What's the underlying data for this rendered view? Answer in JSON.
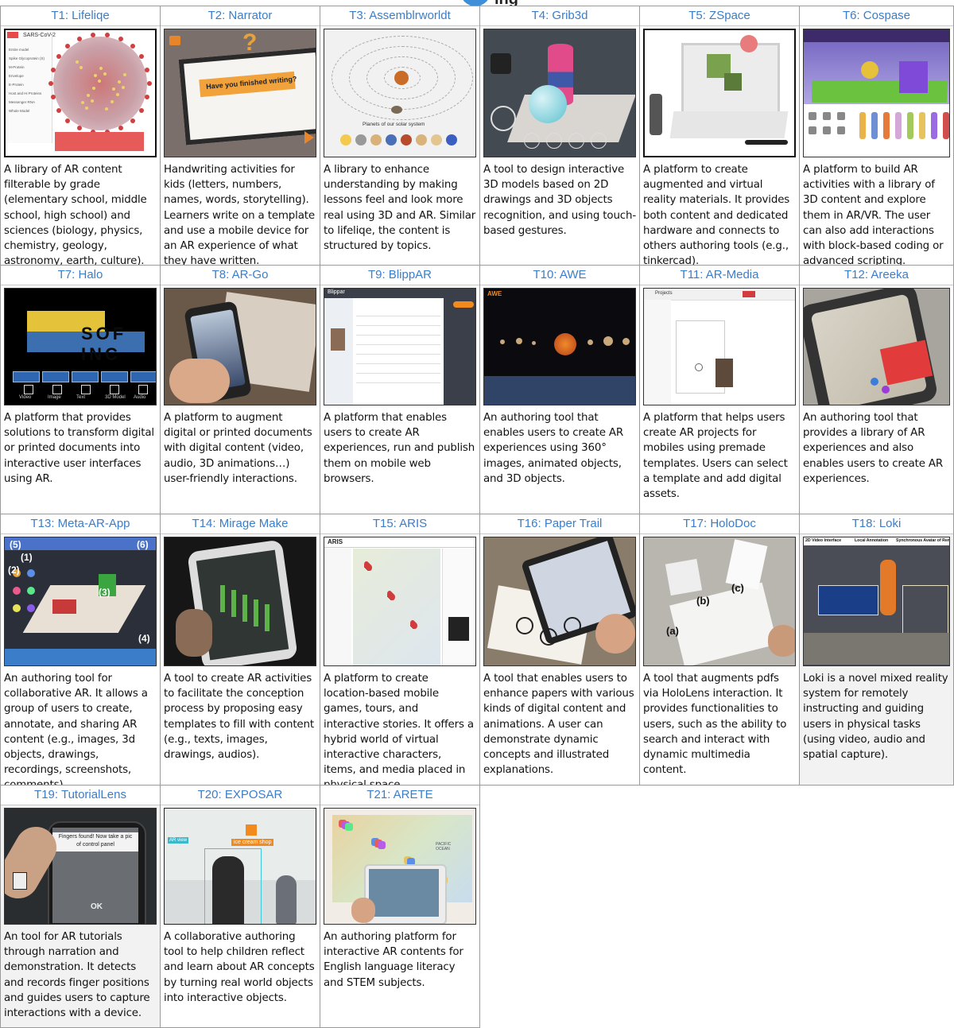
{
  "banner": {
    "text": "ing"
  },
  "tools": [
    {
      "id": "T1",
      "title": "T1: Lifeliqe",
      "image": "virus-model-icon",
      "description": "A library of AR content filterable by grade (elementary school, middle school, high school) and sciences (biology, physics, chemistry, geology, astronomy, earth, culture)."
    },
    {
      "id": "T2",
      "title": "T2: Narrator",
      "image": "handwriting-sheet-icon",
      "description": "Handwriting activities for kids (letters, numbers, names, words, storytelling). Learners write on a template and use a mobile device for an AR experience of what they have written."
    },
    {
      "id": "T3",
      "title": "T3: Assemblrworldt",
      "image": "solar-system-icon",
      "description": "A library to enhance understanding by making lessons feel and look more real using 3D and AR. Similar to lifeliqe, the content is structured by topics."
    },
    {
      "id": "T4",
      "title": "T4: Grib3d",
      "image": "3d-objects-icon",
      "description": "A tool to design interactive 3D models based on 2D drawings and 3D objects recognition, and using touch-based gestures."
    },
    {
      "id": "T5",
      "title": "T5: ZSpace",
      "image": "laptop-hardware-icon",
      "description": "A platform to create augmented and virtual reality materials. It provides both content and dedicated hardware and connects to others authoring tools (e.g., tinkercad)."
    },
    {
      "id": "T6",
      "title": "T6: Cospase",
      "image": "3d-scene-editor-icon",
      "description": "A platform to build AR activities with a library of 3D content and explore them in AR/VR. The user can also add interactions with block-based coding or advanced scripting."
    },
    {
      "id": "T7",
      "title": "T7: Halo",
      "image": "media-toolbar-icon",
      "description": "A platform that provides solutions to transform digital or printed documents into interactive user interfaces using AR."
    },
    {
      "id": "T8",
      "title": "T8: AR-Go",
      "image": "phone-over-book-icon",
      "description": "A platform to augment digital or printed documents with digital content (video, audio, 3D animations…) user-friendly interactions."
    },
    {
      "id": "T9",
      "title": "T9: BlippAR",
      "image": "web-editor-icon",
      "description": "A platform that enables users to create AR experiences, run and publish them on mobile web browsers."
    },
    {
      "id": "T10",
      "title": "T10: AWE",
      "image": "planets-icon",
      "description": "An authoring tool that enables users to create AR experiences using 360° images, animated objects, and 3D objects."
    },
    {
      "id": "T11",
      "title": "T11: AR-Media",
      "image": "project-template-icon",
      "description": "A platform that helps users create AR projects for mobiles using premade templates. Users can select a template and add digital assets."
    },
    {
      "id": "T12",
      "title": "T12: Areeka",
      "image": "phone-ar-cards-icon",
      "description": "An authoring tool that provides a library of AR experiences and also enables users to create AR experiences."
    },
    {
      "id": "T13",
      "title": "T13: Meta-AR-App",
      "image": "collab-workspace-icon",
      "description": "An authoring tool for collaborative AR. It allows a group of users to create, annotate, and sharing AR content (e.g., images, 3d objects, drawings, recordings, screenshots, comments)."
    },
    {
      "id": "T14",
      "title": "T14: Mirage Make",
      "image": "phone-3d-model-icon",
      "description": "A tool to create AR activities to facilitate the conception process by proposing easy templates to fill with content (e.g., texts, images, drawings, audios)."
    },
    {
      "id": "T15",
      "title": "T15: ARIS",
      "image": "location-map-icon",
      "description": "A platform to create location-based mobile games, tours, and interactive stories. It offers a hybrid world of virtual interactive characters, items, and media placed in physical space."
    },
    {
      "id": "T16",
      "title": "T16: Paper Trail",
      "image": "tablet-paper-icon",
      "description": "A tool that enables users to enhance papers with various kinds of digital content and animations. A user can demonstrate dynamic concepts and illustrated explanations."
    },
    {
      "id": "T17",
      "title": "T17: HoloDoc",
      "image": "documents-desk-icon",
      "description": "A tool that augments pdfs via HoloLens interaction. It provides functionalities to users, such as the ability to search and interact with dynamic multimedia content."
    },
    {
      "id": "T18",
      "title": "T18: Loki",
      "image": "mixed-reality-room-icon",
      "description": "Loki is a novel mixed reality system for remotely instructing and guiding users in physical tasks (using video, audio and spatial capture)."
    },
    {
      "id": "T19",
      "title": "T19: TutorialLens",
      "image": "phone-finger-icon",
      "description": "An tool for AR tutorials through narration and demonstration. It detects and records finger positions and guides users to capture interactions with a device."
    },
    {
      "id": "T20",
      "title": "T20: EXPOSAR",
      "image": "children-ar-room-icon",
      "description": "A collaborative authoring tool to help children reflect and learn about AR concepts by turning real world objects into interactive objects."
    },
    {
      "id": "T21",
      "title": "T21: ARETE",
      "image": "tablet-world-map-icon",
      "description": "An authoring platform for interactive AR contents for English language literacy and STEM subjects."
    }
  ],
  "image_text": {
    "t1_label": "SARS-CoV-2",
    "t1_menu": [
      "Entire model",
      "Spike Glycoprotein (S)",
      "M-Protein",
      "Envelope",
      "E-Protein",
      "Host and Hi Proteins",
      "Messenger RNA",
      "Whole Model"
    ],
    "t2_banner": "Have you finished writing?",
    "t3_caption": "Planets of our solar system",
    "t7_logo": "SOF INC",
    "t7_tools": [
      "Video",
      "Image",
      "Text",
      "3D Model",
      "Audio"
    ],
    "t9_brand": "Blippar",
    "t10_brand": "AWE",
    "t11_header": "Projects",
    "t13_marks": [
      "(1)",
      "(2)",
      "(3)",
      "(4)",
      "(5)",
      "(6)"
    ],
    "t15_brand": "ARIS",
    "t17_marks": [
      "(a)",
      "(b)",
      "(c)"
    ],
    "t18_marks": [
      "2D Video Interface",
      "Local Annotation",
      "Synchronous Avatar of Remote User"
    ],
    "t19_prompt": "Fingers found! Now take a pic of control panel",
    "t19_ok": "OK",
    "t20_tag": "ice cream shop",
    "t20_view": "AR view",
    "t21_text": "PACIFIC OCEAN"
  },
  "colors": {
    "title_blue": "#3b7dc9",
    "border": "#9a9a9a",
    "shaded": "#f2f2f2"
  }
}
